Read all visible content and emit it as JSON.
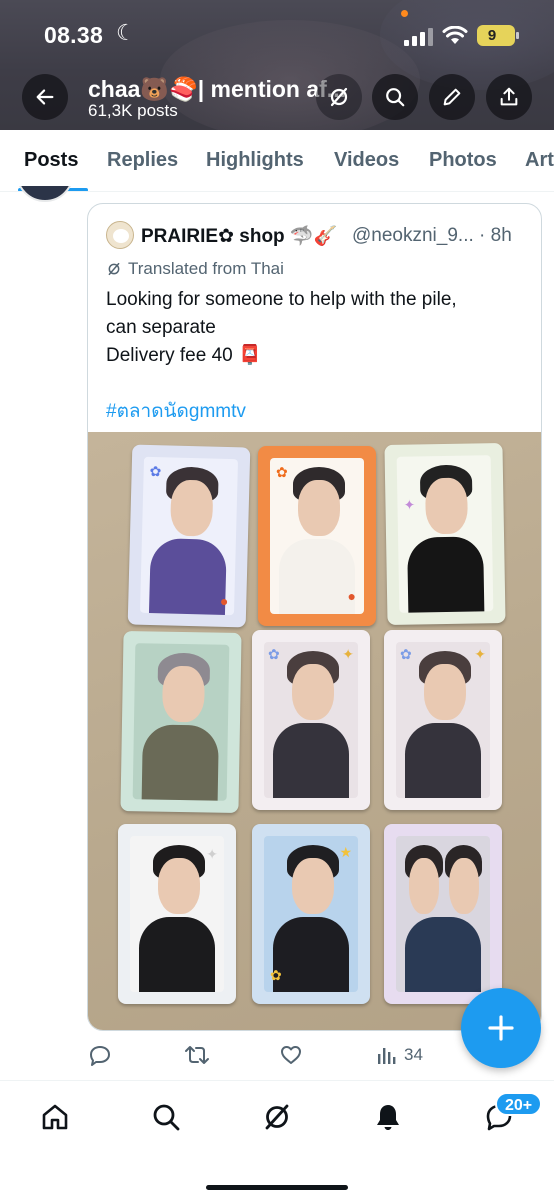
{
  "status_bar": {
    "time": "08.38",
    "battery": "9"
  },
  "profile": {
    "name": "chaa🐻🍣| mention af...",
    "posts_count": "61,3K posts"
  },
  "tabs": [
    {
      "label": "Posts",
      "active": true
    },
    {
      "label": "Replies"
    },
    {
      "label": "Highlights"
    },
    {
      "label": "Videos"
    },
    {
      "label": "Photos"
    },
    {
      "label": "Art"
    }
  ],
  "quoted_post": {
    "author_name": "PRAIRIE✿ shop 🦈🎸",
    "handle_time": "@neokzni_9... · 8h",
    "translated_label": "Translated from Thai",
    "text_lines": [
      "Looking for someone to help with the pile,",
      "can separate",
      "Delivery fee 40 📮"
    ],
    "hashtag": "#ตลาดนัดgmmtv"
  },
  "actions": {
    "views": "34"
  },
  "notifications_badge": "20+",
  "colors": {
    "accent": "#1d9bf0",
    "text_primary": "#0f1419",
    "text_secondary": "#536471",
    "header_bg": "#3e3d47"
  }
}
